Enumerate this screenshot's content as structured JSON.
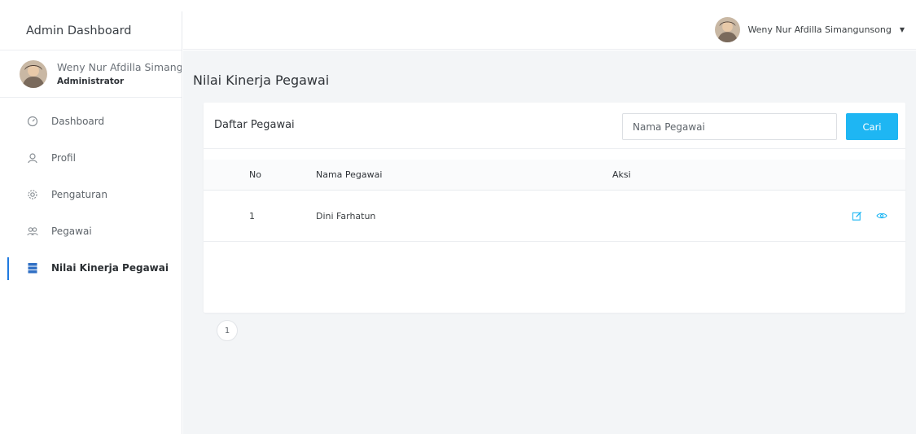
{
  "app": {
    "brand": "Admin Dashboard"
  },
  "user": {
    "name": "Weny Nur Afdilla Simangunsong",
    "role": "Administrator"
  },
  "sidebar": {
    "items": [
      {
        "label": "Dashboard",
        "icon": "dashboard-icon"
      },
      {
        "label": "Profil",
        "icon": "user-icon"
      },
      {
        "label": "Pengaturan",
        "icon": "gear-icon"
      },
      {
        "label": "Pegawai",
        "icon": "users-icon"
      },
      {
        "label": "Nilai Kinerja Pegawai",
        "icon": "server-icon",
        "active": true
      }
    ]
  },
  "header": {
    "user_name": "Weny Nur Afdilla Simangunsong",
    "caret": "▼"
  },
  "main": {
    "title": "Nilai Kinerja Pegawai",
    "card_title": "Daftar Pegawai",
    "search": {
      "placeholder": "Nama Pegawai",
      "value": ""
    },
    "search_button": "Cari",
    "table": {
      "headers": [
        "No",
        "Nama Pegawai",
        "Aksi"
      ],
      "rows": [
        {
          "no": "1",
          "nama": "Dini Farhatun",
          "actions": [
            "edit-icon",
            "eye-icon"
          ]
        }
      ]
    },
    "pagination": {
      "pages": [
        "1"
      ]
    }
  },
  "colors": {
    "accent": "#1eb6f3",
    "active_bar": "#1f7ae0",
    "background": "#f3f5f7"
  }
}
